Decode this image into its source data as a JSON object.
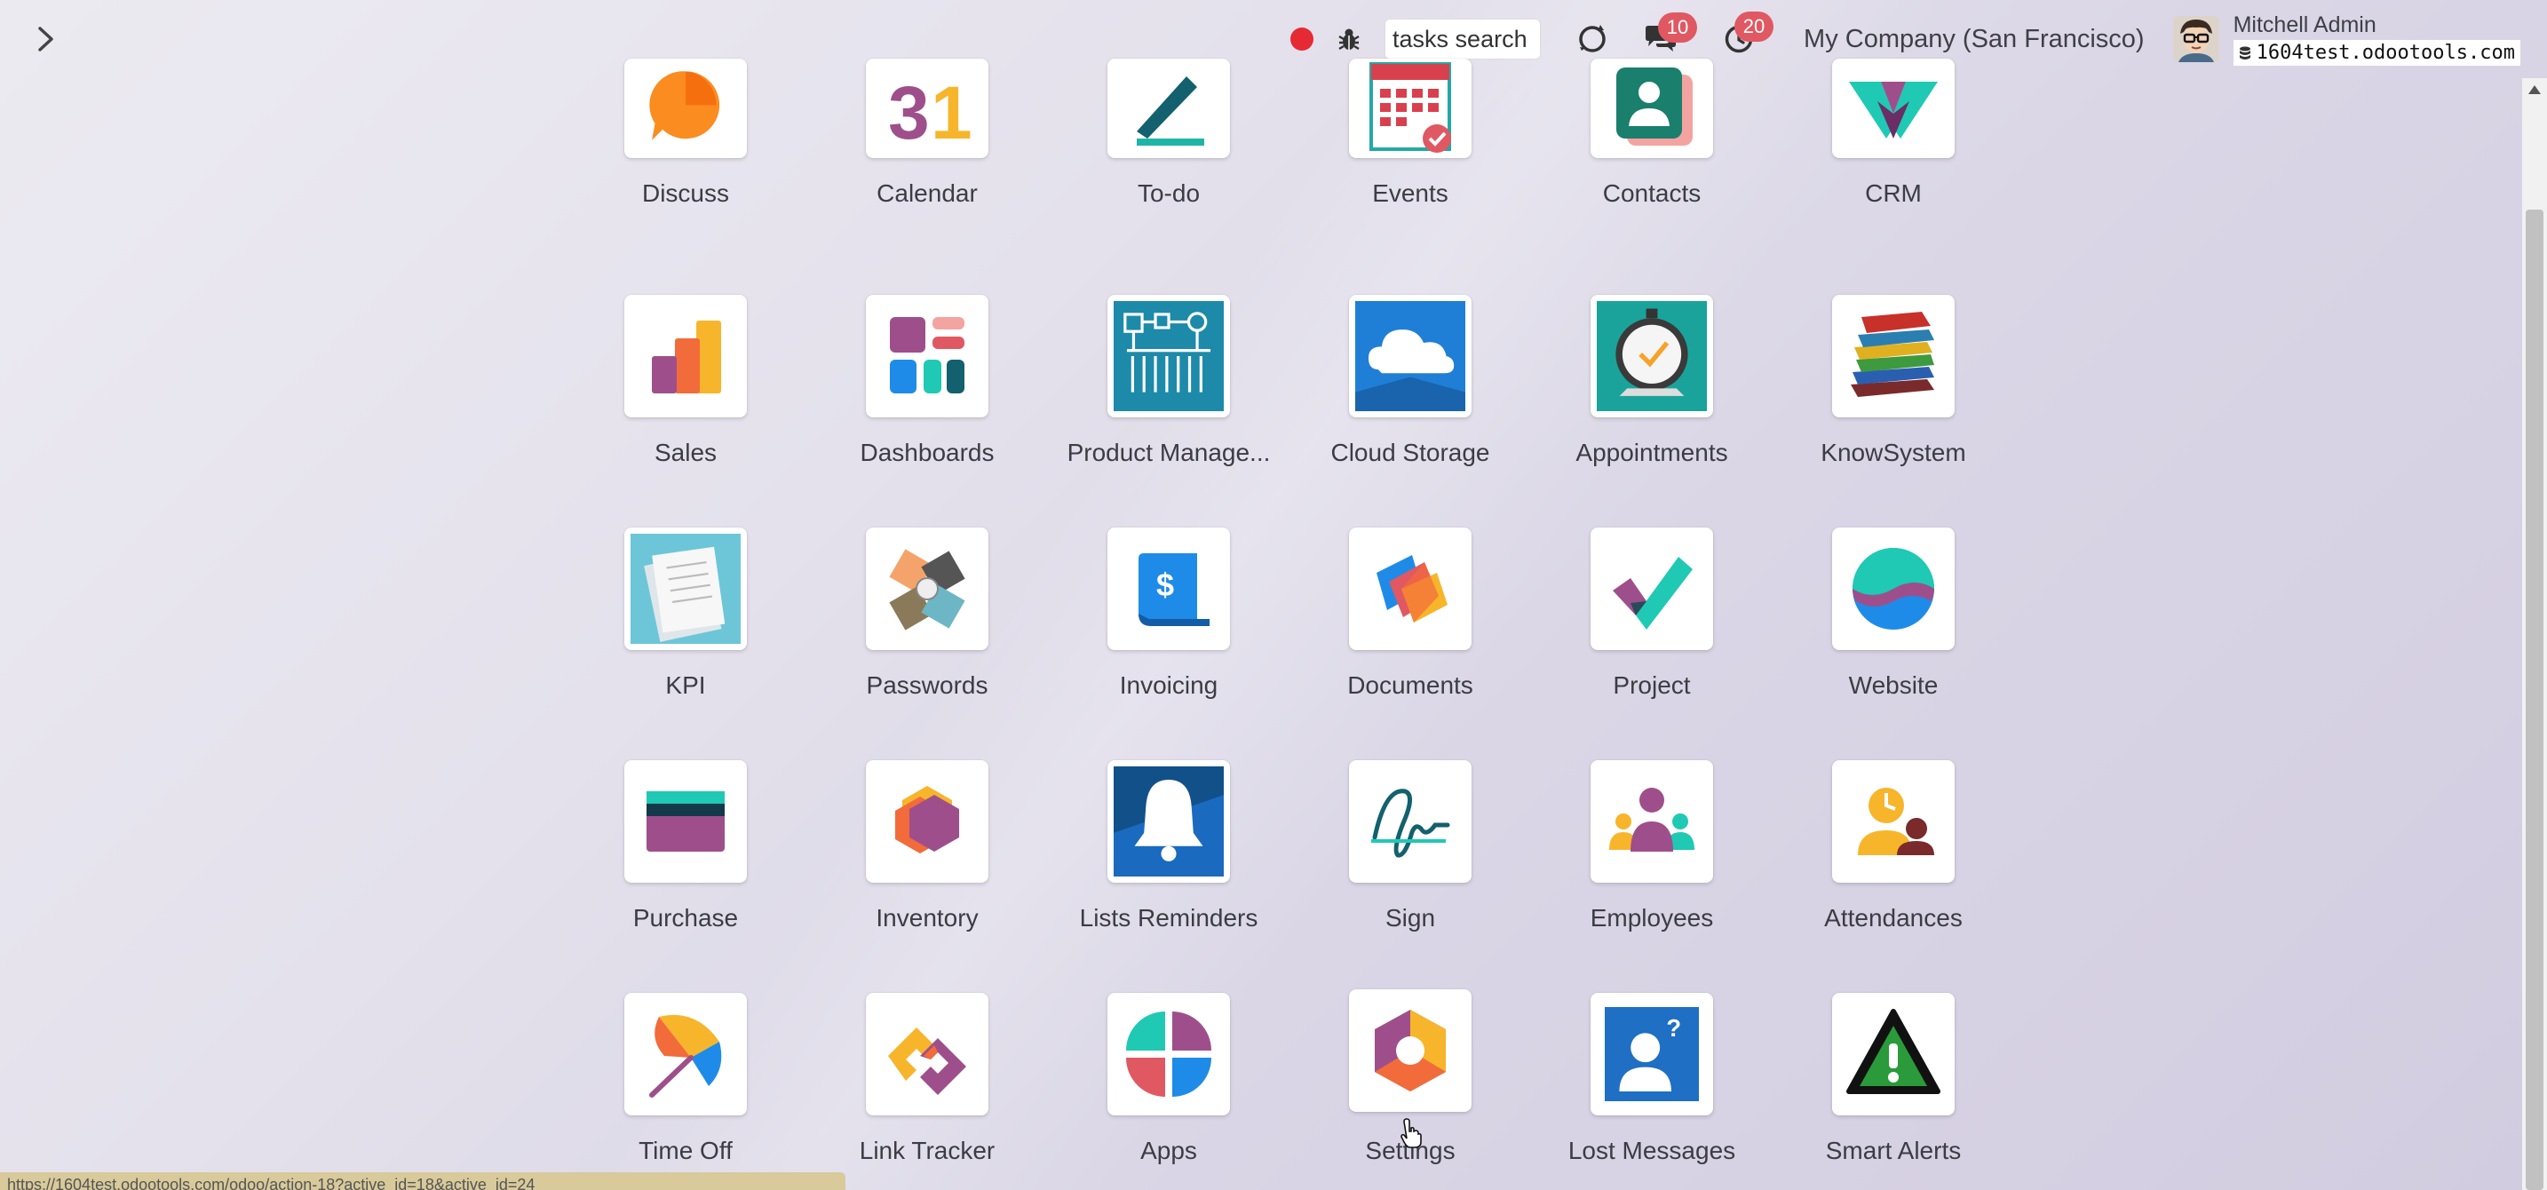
{
  "topbar": {
    "search_text": "tasks search",
    "messages_count": "10",
    "activities_count": "20",
    "company": "My Company (San Francisco)",
    "user_name": "Mitchell Admin",
    "db_name": "1604test.odootools.com"
  },
  "apps": [
    {
      "label": "Discuss",
      "icon": "discuss-icon"
    },
    {
      "label": "Calendar",
      "icon": "calendar-icon"
    },
    {
      "label": "To-do",
      "icon": "todo-icon"
    },
    {
      "label": "Events",
      "icon": "events-icon"
    },
    {
      "label": "Contacts",
      "icon": "contacts-icon"
    },
    {
      "label": "CRM",
      "icon": "crm-icon"
    },
    {
      "label": "Sales",
      "icon": "sales-icon"
    },
    {
      "label": "Dashboards",
      "icon": "dashboards-icon"
    },
    {
      "label": "Product Manage...",
      "icon": "product-management-icon"
    },
    {
      "label": "Cloud Storage",
      "icon": "cloud-storage-icon"
    },
    {
      "label": "Appointments",
      "icon": "appointments-icon"
    },
    {
      "label": "KnowSystem",
      "icon": "knowsystem-icon"
    },
    {
      "label": "KPI",
      "icon": "kpi-icon"
    },
    {
      "label": "Passwords",
      "icon": "passwords-icon"
    },
    {
      "label": "Invoicing",
      "icon": "invoicing-icon"
    },
    {
      "label": "Documents",
      "icon": "documents-icon"
    },
    {
      "label": "Project",
      "icon": "project-icon"
    },
    {
      "label": "Website",
      "icon": "website-icon"
    },
    {
      "label": "Purchase",
      "icon": "purchase-icon"
    },
    {
      "label": "Inventory",
      "icon": "inventory-icon"
    },
    {
      "label": "Lists Reminders",
      "icon": "reminders-icon"
    },
    {
      "label": "Sign",
      "icon": "sign-icon"
    },
    {
      "label": "Employees",
      "icon": "employees-icon"
    },
    {
      "label": "Attendances",
      "icon": "attendances-icon"
    },
    {
      "label": "Time Off",
      "icon": "time-off-icon"
    },
    {
      "label": "Link Tracker",
      "icon": "link-tracker-icon"
    },
    {
      "label": "Apps",
      "icon": "apps-icon"
    },
    {
      "label": "Settings",
      "icon": "settings-icon"
    },
    {
      "label": "Lost Messages",
      "icon": "lost-messages-icon"
    },
    {
      "label": "Smart Alerts",
      "icon": "smart-alerts-icon"
    }
  ],
  "status_url": "https://1604test.odootools.com/odoo/action-18?active_id=18&active_id=24"
}
